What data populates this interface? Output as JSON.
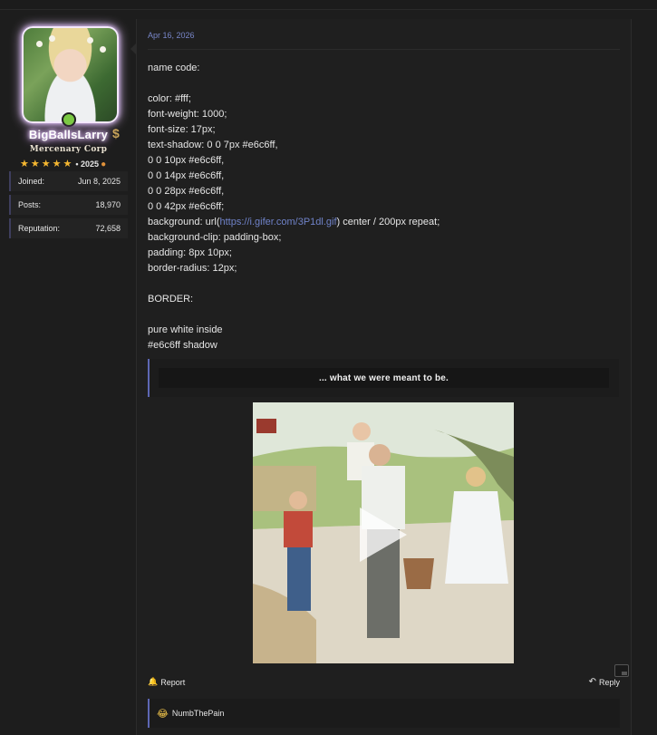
{
  "user": {
    "username": "BigBallsLarry",
    "title": "Mercenary Corp",
    "stars_year": "• 2025",
    "stats": [
      {
        "label": "Joined:",
        "value": "Jun 8, 2025"
      },
      {
        "label": "Posts:",
        "value": "18,970"
      },
      {
        "label": "Reputation:",
        "value": "72,658"
      }
    ]
  },
  "post": {
    "date": "Apr 16, 2026",
    "lines": [
      "name code:",
      "",
      "color: #fff;",
      "font-weight: 1000;",
      "font-size: 17px;",
      "text-shadow: 0 0 7px #e6c6ff,",
      "0 0 10px #e6c6ff,",
      "0 0 14px #e6c6ff,",
      "0 0 28px #e6c6ff,",
      "0 0 42px #e6c6ff;",
      "",
      "background-clip: padding-box;",
      "padding: 8px 10px;",
      "border-radius: 12px;",
      "",
      "BORDER:",
      "",
      "pure white inside",
      "#e6c6ff shadow"
    ],
    "background_line": {
      "prefix": "background: url(",
      "link": "https://i.gifer.com/3P1dl.gif",
      "suffix": ") center / 200px repeat;"
    },
    "quote": "... what we were meant to be.",
    "report_label": "Report",
    "reply_label": "Reply",
    "reaction_user": "NumbThePain"
  },
  "colors": {
    "accent": "#5d67b4",
    "link": "#6f82c8",
    "glow": "#e6c6ff"
  }
}
